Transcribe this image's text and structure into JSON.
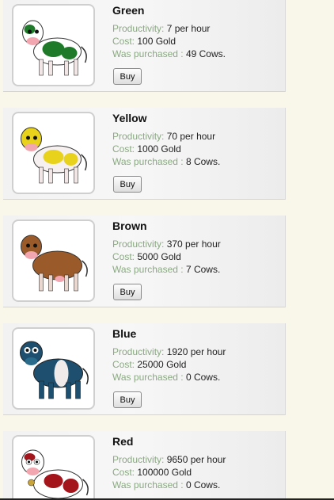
{
  "labels": {
    "productivity": "Productivity:",
    "cost": "Cost:",
    "purchased": "Was purchased :",
    "buy": "Buy"
  },
  "cows": [
    {
      "name": "Green",
      "productivity": "7 per hour",
      "cost": "100 Gold",
      "purchased": "49 Cows.",
      "color": "#1f7a2a",
      "icon": "green-cow-icon"
    },
    {
      "name": "Yellow",
      "productivity": "70 per hour",
      "cost": "1000 Gold",
      "purchased": "8 Cows.",
      "color": "#e8d21c",
      "icon": "yellow-cow-icon"
    },
    {
      "name": "Brown",
      "productivity": "370 per hour",
      "cost": "5000 Gold",
      "purchased": "7 Cows.",
      "color": "#9b5a2a",
      "icon": "brown-cow-icon"
    },
    {
      "name": "Blue",
      "productivity": "1920 per hour",
      "cost": "25000 Gold",
      "purchased": "0 Cows.",
      "color": "#1f4f6e",
      "icon": "blue-cow-icon"
    },
    {
      "name": "Red",
      "productivity": "9650 per hour",
      "cost": "100000 Gold",
      "purchased": "0 Cows.",
      "color": "#a3141b",
      "icon": "red-cow-icon"
    }
  ]
}
